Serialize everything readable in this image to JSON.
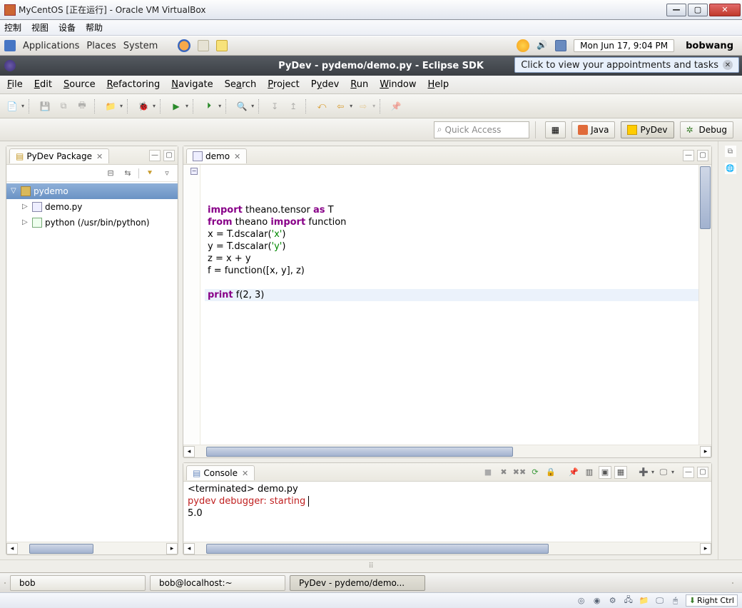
{
  "vb": {
    "title": "MyCentOS [正在运行] - Oracle VM VirtualBox",
    "menu": [
      "控制",
      "视图",
      "设备",
      "帮助"
    ],
    "rightctrl": "Right Ctrl"
  },
  "gnome_top": {
    "menus": [
      "Applications",
      "Places",
      "System"
    ],
    "datetime": "Mon Jun 17,  9:04 PM",
    "user": "bobwang"
  },
  "eclipse": {
    "title": "PyDev - pydemo/demo.py - Eclipse SDK",
    "appointments": "Click to view your appointments and tasks",
    "menubar": [
      {
        "u": "F",
        "rest": "ile"
      },
      {
        "u": "E",
        "rest": "dit"
      },
      {
        "u": "S",
        "rest": "ource"
      },
      {
        "u": "R",
        "rest": "efactoring"
      },
      {
        "u": "N",
        "rest": "avigate"
      },
      {
        "u": "",
        "rest": "Se",
        "u2": "a",
        "rest2": "rch"
      },
      {
        "u": "P",
        "rest": "roject"
      },
      {
        "u": "",
        "rest": "P",
        "u2": "y",
        "rest2": "dev"
      },
      {
        "u": "R",
        "rest": "un"
      },
      {
        "u": "W",
        "rest": "indow"
      },
      {
        "u": "H",
        "rest": "elp"
      }
    ],
    "quick_access_placeholder": "Quick Access",
    "perspectives": {
      "java": "Java",
      "pydev": "PyDev",
      "debug": "Debug"
    }
  },
  "package_explorer": {
    "tab": "PyDev Package",
    "project": "pydemo",
    "children": [
      {
        "label": "demo.py"
      },
      {
        "label": "python  (/usr/bin/python)"
      }
    ]
  },
  "editor": {
    "tab": "demo",
    "code_lines": [
      {
        "html": "<span class='kw'>import</span> theano.tensor <span class='kw'>as</span> T"
      },
      {
        "html": "<span class='kw'>from</span> theano <span class='kw'>import</span> function"
      },
      {
        "html": "x = T.dscalar(<span class='str'>'x'</span>)"
      },
      {
        "html": "y = T.dscalar(<span class='str'>'y'</span>)"
      },
      {
        "html": "z = x + y"
      },
      {
        "html": "f = function([x, y], z)"
      },
      {
        "html": ""
      },
      {
        "html": "<span class='kw'>print</span> f(2, 3)",
        "hl": true
      }
    ]
  },
  "console": {
    "tab": "Console",
    "header": "<terminated> demo.py",
    "line_red": "pydev debugger: starting",
    "output": "5.0"
  },
  "gnome_bottom": {
    "tasks": [
      {
        "label": "bob"
      },
      {
        "label": "bob@localhost:~"
      },
      {
        "label": "PyDev - pydemo/demo...",
        "active": true
      }
    ]
  }
}
